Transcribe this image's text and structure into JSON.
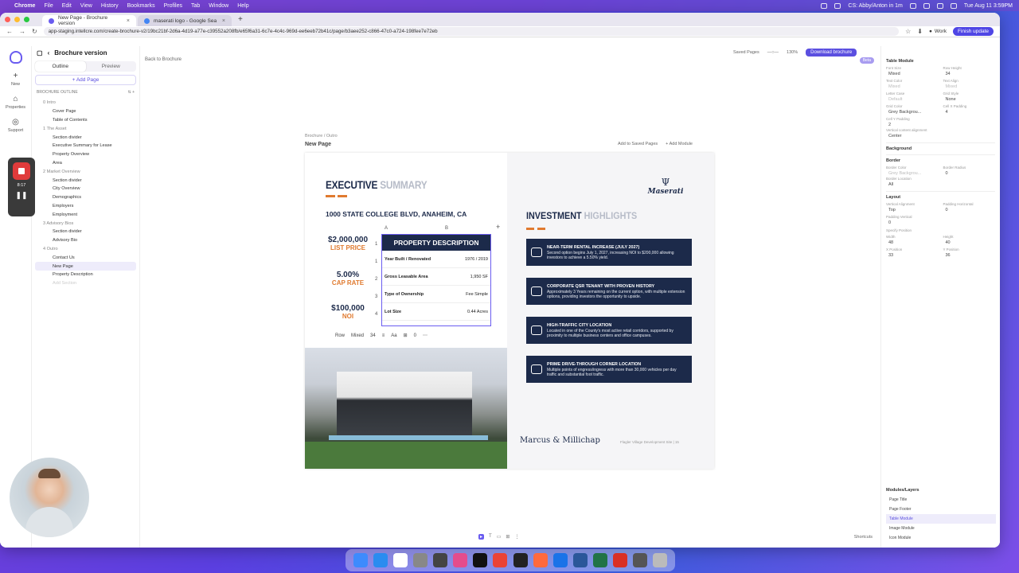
{
  "menubar": {
    "app": "Chrome",
    "items": [
      "File",
      "Edit",
      "View",
      "History",
      "Bookmarks",
      "Profiles",
      "Tab",
      "Window",
      "Help"
    ],
    "event": "CS: Abby/Anton in 1m",
    "clock": "Tue Aug 11  3:59PM"
  },
  "browser": {
    "tabs": [
      "New Page - Brochure version",
      "maserati logo - Google Sea"
    ],
    "url": "app-staging.intellcre.com/create-brochure-v2/19bc21bf-2d6a-4d19-a77e-c39552a208fb/e65f6a31-6c7e-4c4c-969d-ee6eeb72b41c/page/b3aee252-c866-47c0-a724-198fee7e72eb",
    "profile": "Work",
    "update": "Finish update"
  },
  "rail": {
    "new": "New",
    "properties": "Properties",
    "support": "Support"
  },
  "sidebar": {
    "title": "Brochure version",
    "tab_outline": "Outline",
    "tab_preview": "Preview",
    "add_page": "+ Add Page",
    "outline_label": "BROCHURE OUTLINE",
    "rows": [
      {
        "t": "0  Intro",
        "k": "sec"
      },
      {
        "t": "Cover Page",
        "k": "itm"
      },
      {
        "t": "Table of Contents",
        "k": "itm"
      },
      {
        "t": "1  The Asset",
        "k": "sec"
      },
      {
        "t": "Section divider",
        "k": "itm"
      },
      {
        "t": "Executive Summary for Lease",
        "k": "itm"
      },
      {
        "t": "Property Overview",
        "k": "itm"
      },
      {
        "t": "Area",
        "k": "itm"
      },
      {
        "t": "2  Market Overview",
        "k": "sec"
      },
      {
        "t": "Section divider",
        "k": "itm"
      },
      {
        "t": "City Overview",
        "k": "itm"
      },
      {
        "t": "Demographics",
        "k": "itm"
      },
      {
        "t": "Employers",
        "k": "itm"
      },
      {
        "t": "Employment",
        "k": "itm"
      },
      {
        "t": "3  Advisory Bios",
        "k": "sec"
      },
      {
        "t": "Section divider",
        "k": "itm"
      },
      {
        "t": "Advisory Bio",
        "k": "itm"
      },
      {
        "t": "4  Outro",
        "k": "sec"
      },
      {
        "t": "Contact Us",
        "k": "itm"
      },
      {
        "t": "New Page",
        "k": "itm sel"
      },
      {
        "t": "Property Description",
        "k": "itm"
      },
      {
        "t": "Add Section",
        "k": "itm faint"
      }
    ]
  },
  "recorder": {
    "time": "8:17"
  },
  "canvas": {
    "back": "Back to Brochure",
    "beta": "Beta",
    "crumb": "Brochure  /  Outro",
    "page_name": "New Page",
    "add_saved": "Add to Saved Pages",
    "add_module": "+ Add Module",
    "shortcuts": "Shortcuts"
  },
  "brochure": {
    "exec_a": "EXECUTIVE",
    "exec_b": "SUMMARY",
    "address": "1000 STATE COLLEGE BLVD, ANAHEIM, CA",
    "stats": [
      {
        "v": "$2,000,000",
        "l": "LIST PRICE"
      },
      {
        "v": "5.00%",
        "l": "CAP RATE"
      },
      {
        "v": "$100,000",
        "l": "NOI"
      }
    ],
    "col_a": "A",
    "col_b": "B",
    "table_title": "PROPERTY DESCRIPTION",
    "rows": [
      {
        "n": "1",
        "k": "Year Built / Renovated",
        "v": "1976 / 2019"
      },
      {
        "n": "2",
        "k": "Gross Leasable Area",
        "v": "1,950 SF"
      },
      {
        "n": "3",
        "k": "Type of Ownership",
        "v": "Fee Simple"
      },
      {
        "n": "4",
        "k": "Lot Size",
        "v": "0.44 Acres"
      }
    ],
    "toolbar": {
      "row": "Row",
      "mixed": "Mixed",
      "size": "34",
      "aa": "Aa",
      "zero": "0"
    },
    "logo_word": "Maserati",
    "inv_a": "INVESTMENT",
    "inv_b": "HIGHLIGHTS",
    "highlights": [
      {
        "t": "NEAR-TERM RENTAL INCREASE (JULY 2027)",
        "d": "Second option begins July 1, 2027, increasing NOI to $200,000 allowing investors to achieve a 5.50% yield."
      },
      {
        "t": "CORPORATE QSR TENANT WITH PROVEN HISTORY",
        "d": "Approximately 3 Years remaining on the current option, with multiple extension options, providing investors the opportunity to upside."
      },
      {
        "t": "HIGH-TRAFFIC CITY LOCATION",
        "d": "Located in one of the County's most active retail corridors, supported by proximity to multiple business centers and office campuses."
      },
      {
        "t": "PRIME DRIVE-THROUGH CORNER LOCATION",
        "d": "Multiple points of engress/ingress with more than 30,000 vehicles per day traffic and substantial foot traffic."
      }
    ],
    "brand": "Marcus & Millichap",
    "footer": "Flagler Village Development Site  |  15"
  },
  "panel": {
    "saved": "Saved Pages",
    "zoom": "130%",
    "download": "Download brochure",
    "module": "Table Module",
    "font_size_l": "Font Size",
    "font_size": "Mixed",
    "row_height_l": "Row Height",
    "row_height": "34",
    "text_color_l": "Text Color",
    "text_color": "Mixed",
    "text_align_l": "Text Align",
    "text_align": "Mixed",
    "letter_case_l": "Letter Case",
    "letter_case": "Default",
    "grid_style_l": "Grid Style",
    "grid_style": "None",
    "grid_color_l": "Grid Color",
    "grid_color": "Grey Backgrou...",
    "cell_x_l": "Cell X Padding",
    "cell_x": "4",
    "cell_y_l": "Cell Y Padding",
    "cell_y": "2",
    "valign_l": "Vertical content alignment",
    "valign": "Center",
    "background": "Background",
    "border": "Border",
    "border_color_l": "Border Color",
    "border_color": "Grey Backgrou...",
    "border_radius_l": "Border Radius",
    "border_radius": "0",
    "border_loc_l": "Border Location",
    "border_loc": "All",
    "layout": "Layout",
    "v_align_l": "Vertical Alignment",
    "v_align": "Top",
    "pad_h_l": "Padding Horizontal",
    "pad_h": "0",
    "pad_v_l": "Padding Vertical",
    "pad_v": "0",
    "specify": "Specify Position",
    "width_l": "Width",
    "width": "48",
    "height_l": "Height",
    "height": "40",
    "x_l": "X Position",
    "x": "33",
    "y_l": "Y Position",
    "y": "36",
    "modules_title": "Modules/Layers",
    "modules": [
      "Page Title",
      "Page Footer",
      "Table Module",
      "Image Module",
      "Icon Module"
    ]
  }
}
